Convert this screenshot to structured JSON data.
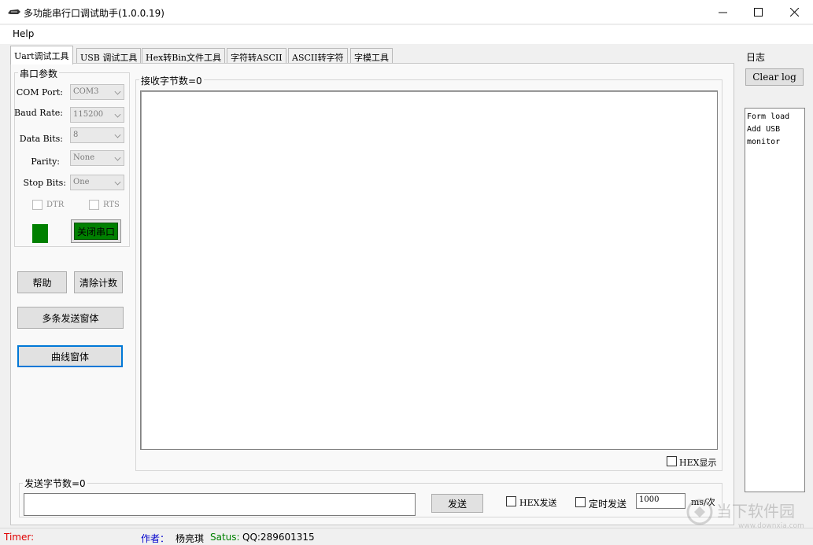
{
  "window": {
    "title": "多功能串行口调试助手(1.0.0.19)",
    "minimize": "—",
    "maximize": "☐",
    "close": "✕"
  },
  "menu": {
    "help": "Help"
  },
  "tabs": [
    {
      "label": "Uart调试工具",
      "active": true
    },
    {
      "label": "USB 调试工具",
      "active": false
    },
    {
      "label": "Hex转Bin文件工具",
      "active": false
    },
    {
      "label": "字符转ASCII",
      "active": false
    },
    {
      "label": "ASCII转字符",
      "active": false
    },
    {
      "label": "字模工具",
      "active": false
    }
  ],
  "serial": {
    "group_title": "串口参数",
    "com_port": {
      "label": "COM Port:",
      "value": "COM3"
    },
    "baud_rate": {
      "label": "Baud Rate:",
      "value": "115200"
    },
    "data_bits": {
      "label": "Data Bits:",
      "value": "8"
    },
    "parity": {
      "label": "Parity:",
      "value": "None"
    },
    "stop_bits": {
      "label": "Stop Bits:",
      "value": "One"
    },
    "dtr": "DTR",
    "rts": "RTS",
    "status_color": "#008000",
    "close_port": "关闭串口"
  },
  "buttons": {
    "help": "帮助",
    "clear_count": "清除计数",
    "multi_send": "多条发送窗体",
    "curve": "曲线窗体"
  },
  "receive": {
    "label": "接收字节数=0",
    "hex_display": "HEX显示"
  },
  "send": {
    "label": "发送字节数=0",
    "send_button": "发送",
    "hex_send": "HEX发送",
    "timed_send": "定时发送",
    "interval": "1000",
    "interval_unit": "ms/次"
  },
  "log": {
    "title": "日志",
    "clear": "Clear log",
    "lines": [
      "Form load",
      "Add USB",
      "monitor"
    ]
  },
  "status": {
    "timer_label": "Timer:",
    "author_label": "作者：",
    "author": "杨亮琪",
    "satus_label": "Satus:",
    "qq": "QQ:289601315"
  },
  "watermark": {
    "text": "当下软件园",
    "url": "www.downxia.com"
  },
  "colors": {
    "status_red": "#e00000",
    "author_blue": "#0000cc",
    "satus_green": "#008000",
    "focus_blue": "#0078d7"
  }
}
